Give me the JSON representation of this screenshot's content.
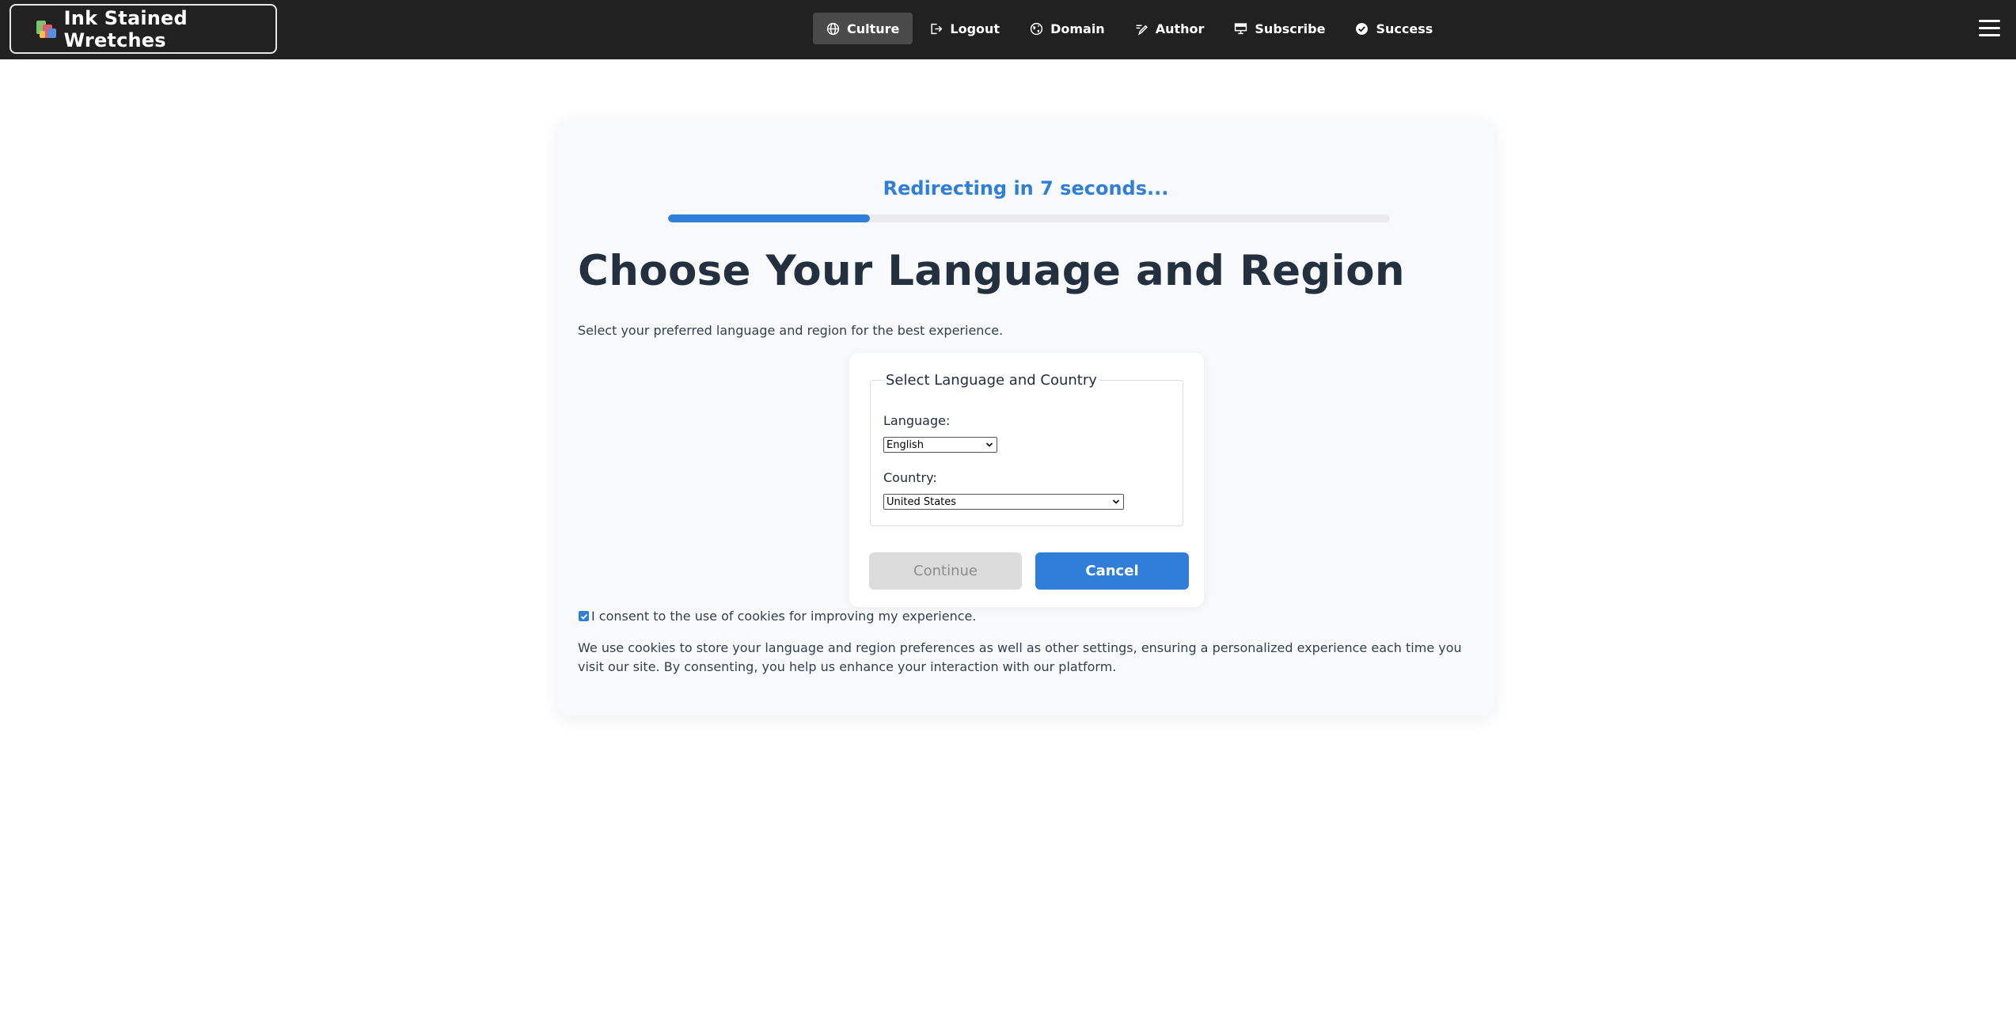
{
  "brand": {
    "name": "Ink Stained Wretches"
  },
  "nav": {
    "items": [
      {
        "label": "Culture",
        "icon": "globe-icon",
        "active": true
      },
      {
        "label": "Logout",
        "icon": "logout-icon"
      },
      {
        "label": "Domain",
        "icon": "domain-globe-icon"
      },
      {
        "label": "Author",
        "icon": "pen-icon"
      },
      {
        "label": "Subscribe",
        "icon": "monitor-icon"
      },
      {
        "label": "Success",
        "icon": "check-circle-icon"
      }
    ],
    "menu_icon": "hamburger-menu-icon"
  },
  "redirect": {
    "text": "Redirecting in 7 seconds...",
    "progress_percent": 28
  },
  "page": {
    "title": "Choose Your Language and Region",
    "subtitle": "Select your preferred language and region for the best experience."
  },
  "form": {
    "legend": "Select Language and Country",
    "language_label": "Language:",
    "language_value": "English",
    "country_label": "Country:",
    "country_value": "United States",
    "continue_label": "Continue",
    "cancel_label": "Cancel"
  },
  "consent": {
    "checked": true,
    "label": "I consent to the use of cookies for improving my experience.",
    "details": "We use cookies to store your language and region preferences as well as other settings, ensuring a personalized experience each time you visit our site. By consenting, you help us enhance your interaction with our platform."
  },
  "colors": {
    "navbar": "#212121",
    "accent": "#2f7fd8",
    "card_bg": "#f8f9fa",
    "disabled_button": "#dcdcdc"
  }
}
